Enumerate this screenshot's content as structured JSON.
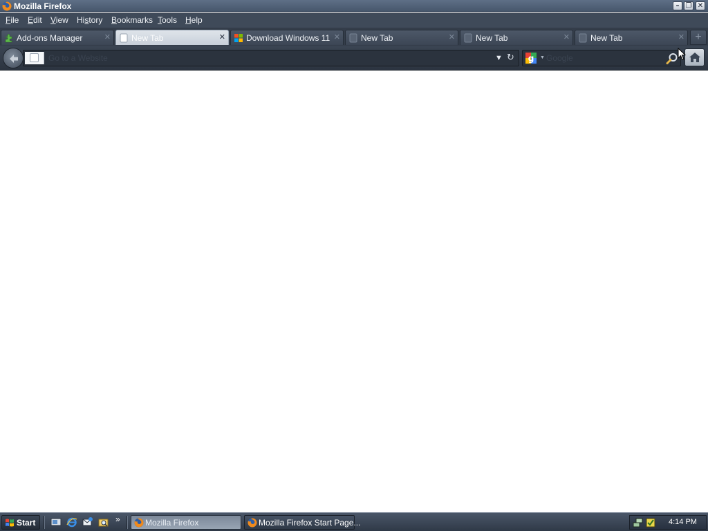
{
  "window": {
    "title": "Mozilla Firefox"
  },
  "menu": [
    "File",
    "Edit",
    "View",
    "History",
    "Bookmarks",
    "Tools",
    "Help"
  ],
  "menu_mnemonics": [
    "F",
    "E",
    "V",
    "s",
    "B",
    "T",
    "H"
  ],
  "tabs": [
    {
      "label": "Add-ons Manager",
      "icon": "puzzle-icon",
      "active": false
    },
    {
      "label": "New Tab",
      "icon": "blank-page-icon",
      "active": true
    },
    {
      "label": "Download Windows 11",
      "icon": "windows-logo-icon",
      "active": false
    },
    {
      "label": "New Tab",
      "icon": "blank-page-icon",
      "active": false
    },
    {
      "label": "New Tab",
      "icon": "blank-page-icon",
      "active": false
    },
    {
      "label": "New Tab",
      "icon": "blank-page-icon",
      "active": false
    }
  ],
  "urlbar": {
    "placeholder": "Go to a Website",
    "value": ""
  },
  "searchbar": {
    "placeholder": "Google",
    "engine_icon": "google-icon"
  },
  "taskbar": {
    "start_label": "Start",
    "tasks": [
      {
        "label": "Mozilla Firefox",
        "active": true
      },
      {
        "label": "Mozilla Firefox Start Page...",
        "active": false
      }
    ],
    "clock": "4:14 PM"
  },
  "colors": {
    "chrome_dark": "#343d4a",
    "title_bar": "#5e6f86",
    "active_tab": "#dfe4ea",
    "content_bg": "#ffffff"
  }
}
